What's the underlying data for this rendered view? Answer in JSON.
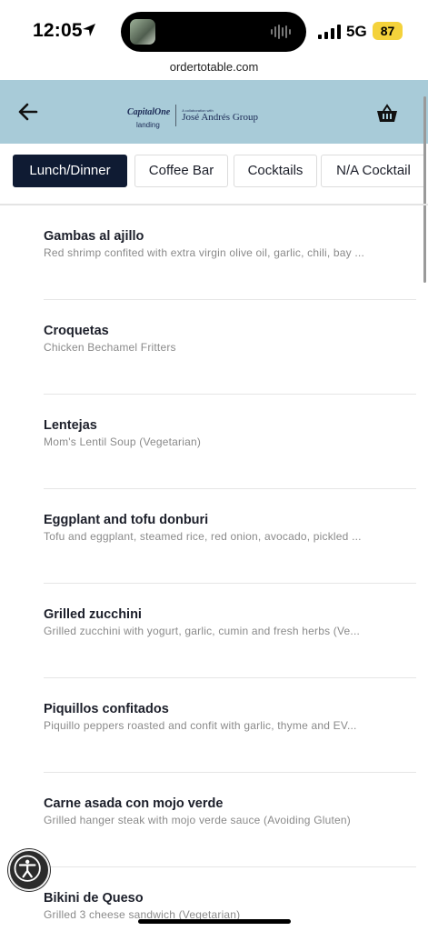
{
  "status": {
    "time": "12:05",
    "network": "5G",
    "battery": "87",
    "icons": [
      "location-arrow-icon",
      "signal-icon"
    ]
  },
  "browser": {
    "url": "ordertotable.com"
  },
  "header": {
    "back_icon": "arrow-left-icon",
    "basket_icon": "basket-icon",
    "logo": {
      "brand_a": "CapitalOne",
      "brand_a_sub": "landing",
      "collab": "A collaboration with",
      "brand_b": "José Andrés Group"
    },
    "colors": {
      "header_bg": "#a8cbd8",
      "active_tab": "#0f1b33"
    }
  },
  "tabs": [
    {
      "label": "Lunch/Dinner",
      "active": true
    },
    {
      "label": "Coffee Bar",
      "active": false
    },
    {
      "label": "Cocktails",
      "active": false
    },
    {
      "label": "N/A Cocktail",
      "active": false
    }
  ],
  "menu": [
    {
      "name": "Gambas al ajillo",
      "desc": "Red shrimp confited with extra virgin olive oil, garlic, chili, bay ..."
    },
    {
      "name": "Croquetas",
      "desc": "Chicken Bechamel Fritters"
    },
    {
      "name": "Lentejas",
      "desc": "Mom's Lentil Soup (Vegetarian)"
    },
    {
      "name": "Eggplant and tofu donburi",
      "desc": "Tofu and eggplant, steamed rice, red onion, avocado, pickled ..."
    },
    {
      "name": "Grilled zucchini",
      "desc": "Grilled zucchini with yogurt, garlic, cumin and fresh herbs (Ve..."
    },
    {
      "name": "Piquillos confitados",
      "desc": "Piquillo peppers roasted and confit with garlic, thyme and EV..."
    },
    {
      "name": "Carne asada con mojo verde",
      "desc": "Grilled hanger steak with mojo verde sauce (Avoiding Gluten)"
    },
    {
      "name": "Bikini de Queso",
      "desc": "Grilled 3 cheese sandwich (Vegetarian)"
    }
  ],
  "floating": {
    "accessibility_icon": "accessibility-icon"
  }
}
